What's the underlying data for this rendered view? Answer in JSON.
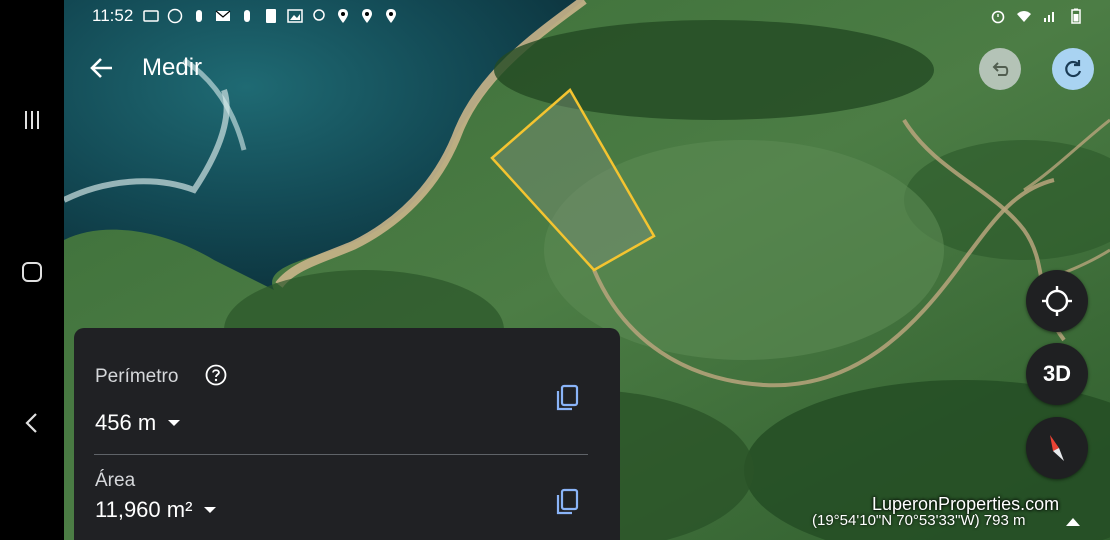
{
  "status": {
    "time": "11:52"
  },
  "header": {
    "title": "Medir",
    "back_icon": "arrow-back-icon",
    "undo_icon": "undo-icon",
    "redo_icon": "redo-icon"
  },
  "panel": {
    "perimeter_label": "Perímetro",
    "perimeter_value": "456 m",
    "area_label": "Área",
    "area_value": "11,960 m²",
    "help_icon": "help-circle-icon",
    "copy_icon": "copy-icon"
  },
  "controls": {
    "location_icon": "my-location-icon",
    "three_d_label": "3D",
    "compass_icon": "compass-icon"
  },
  "footer": {
    "watermark": "LuperonProperties.com",
    "coordinates": "(19°54'10\"N 70°53'33\"W) 793 m"
  },
  "colors": {
    "panel_bg": "#202124",
    "polygon_stroke": "#f4c430",
    "redo_bg": "#a9d3f2",
    "copy_icon": "#8ab4f8"
  }
}
